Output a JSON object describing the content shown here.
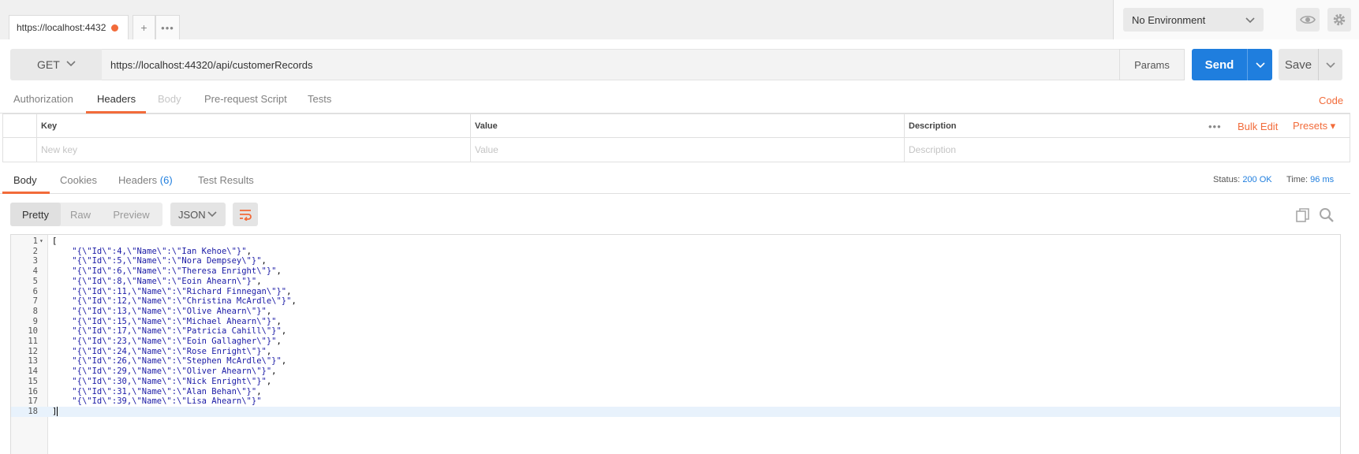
{
  "tabs": {
    "active_tab": "https://localhost:4432",
    "add_label": "+",
    "more_label": "•••"
  },
  "environment": {
    "selected": "No Environment"
  },
  "request": {
    "method": "GET",
    "url": "https://localhost:44320/api/customerRecords",
    "params_label": "Params",
    "send_label": "Send",
    "save_label": "Save"
  },
  "request_tabs": [
    {
      "label": "Authorization"
    },
    {
      "label": "Headers"
    },
    {
      "label": "Body"
    },
    {
      "label": "Pre-request Script"
    },
    {
      "label": "Tests"
    }
  ],
  "code_label": "Code",
  "headers_table": {
    "columns": [
      "Key",
      "Value",
      "Description"
    ],
    "placeholders": [
      "New key",
      "Value",
      "Description"
    ],
    "more_label": "•••",
    "bulk_edit_label": "Bulk Edit",
    "presets_label": "Presets ▾"
  },
  "response": {
    "tabs": [
      {
        "label": "Body"
      },
      {
        "label": "Cookies"
      },
      {
        "label": "Headers"
      },
      {
        "label": "Test Results"
      }
    ],
    "headers_count": "(6)",
    "status_label": "Status:",
    "status_value": "200 OK",
    "time_label": "Time:",
    "time_value": "96 ms",
    "formats": [
      "Pretty",
      "Raw",
      "Preview"
    ],
    "language": "JSON"
  },
  "body_lines": [
    "[",
    "    \"{\\\"Id\\\":4,\\\"Name\\\":\\\"Ian Kehoe\\\"}\",",
    "    \"{\\\"Id\\\":5,\\\"Name\\\":\\\"Nora Dempsey\\\"}\",",
    "    \"{\\\"Id\\\":6,\\\"Name\\\":\\\"Theresa Enright\\\"}\",",
    "    \"{\\\"Id\\\":8,\\\"Name\\\":\\\"Eoin Ahearn\\\"}\",",
    "    \"{\\\"Id\\\":11,\\\"Name\\\":\\\"Richard Finnegan\\\"}\",",
    "    \"{\\\"Id\\\":12,\\\"Name\\\":\\\"Christina McArdle\\\"}\",",
    "    \"{\\\"Id\\\":13,\\\"Name\\\":\\\"Olive Ahearn\\\"}\",",
    "    \"{\\\"Id\\\":15,\\\"Name\\\":\\\"Michael Ahearn\\\"}\",",
    "    \"{\\\"Id\\\":17,\\\"Name\\\":\\\"Patricia Cahill\\\"}\",",
    "    \"{\\\"Id\\\":23,\\\"Name\\\":\\\"Eoin Gallagher\\\"}\",",
    "    \"{\\\"Id\\\":24,\\\"Name\\\":\\\"Rose Enright\\\"}\",",
    "    \"{\\\"Id\\\":26,\\\"Name\\\":\\\"Stephen McArdle\\\"}\",",
    "    \"{\\\"Id\\\":29,\\\"Name\\\":\\\"Oliver Ahearn\\\"}\",",
    "    \"{\\\"Id\\\":30,\\\"Name\\\":\\\"Nick Enright\\\"}\",",
    "    \"{\\\"Id\\\":31,\\\"Name\\\":\\\"Alan Behan\\\"}\",",
    "    \"{\\\"Id\\\":39,\\\"Name\\\":\\\"Lisa Ahearn\\\"}\"",
    "]"
  ],
  "colors": {
    "accent": "#f26b3a",
    "send_blue": "#1f7ede",
    "string_blue": "#1a1aa6"
  }
}
